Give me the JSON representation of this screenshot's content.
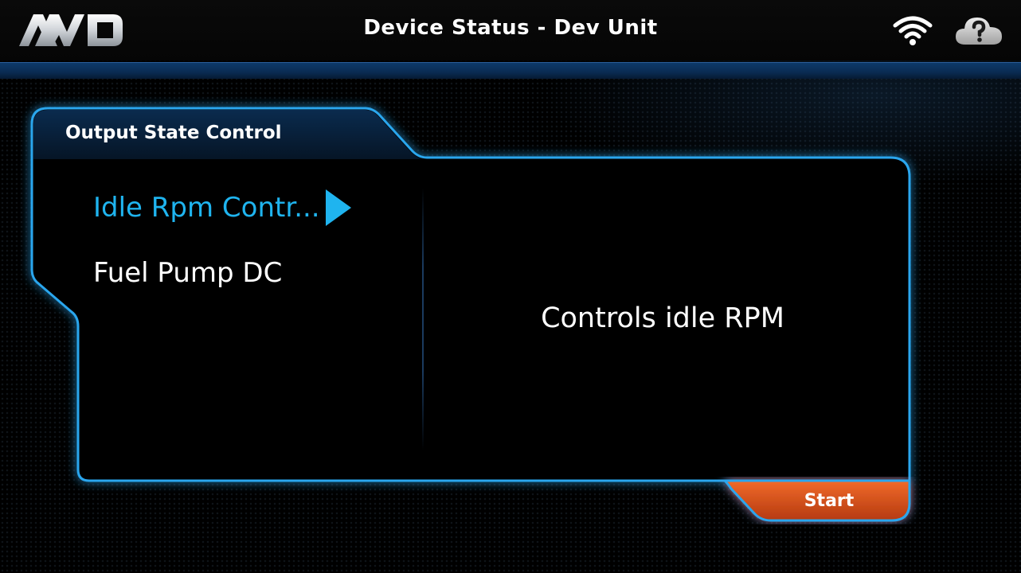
{
  "header": {
    "title": "Device Status - Dev Unit",
    "logo": "AMP-logo",
    "icons": [
      "wifi-icon",
      "cloud-help-icon"
    ]
  },
  "panel": {
    "title": "Output State Control",
    "items": [
      {
        "label": "Idle Rpm Contr...",
        "selected": true
      },
      {
        "label": "Fuel Pump DC",
        "selected": false
      }
    ],
    "description": "Controls idle RPM",
    "start_label": "Start"
  },
  "colors": {
    "accent": "#1fb4ef",
    "panel_border": "#2aa6ee",
    "start_button": "#e2551e",
    "header_bar": "#0d3a6a"
  }
}
